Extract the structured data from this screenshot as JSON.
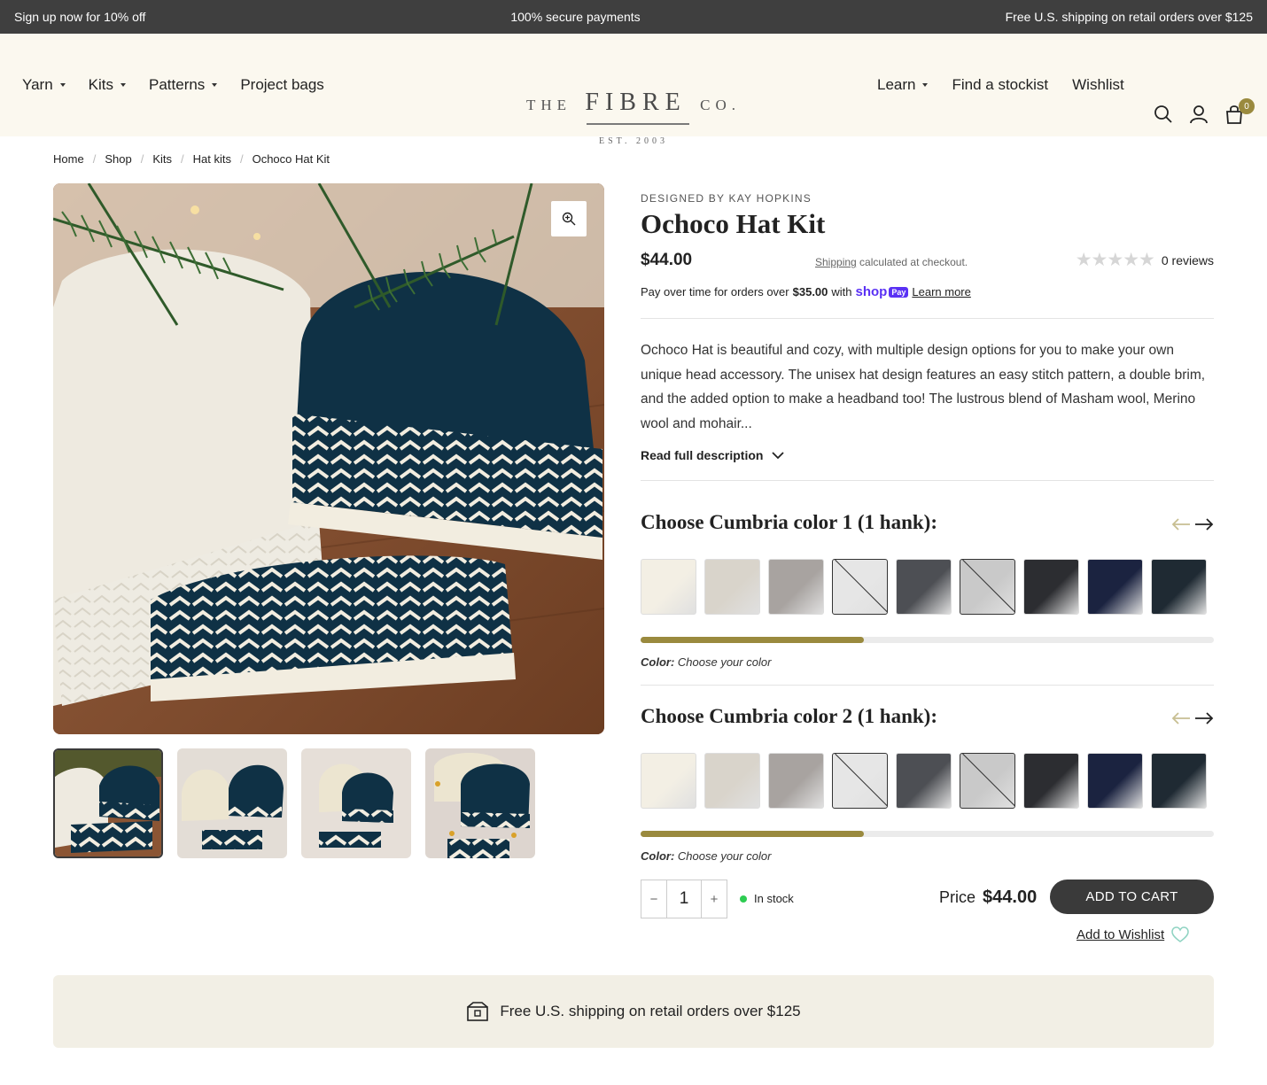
{
  "announcement": {
    "left": "Sign up now for 10% off",
    "center": "100% secure payments",
    "right": "Free U.S. shipping on retail orders over $125"
  },
  "nav": {
    "left": [
      {
        "label": "Yarn",
        "dropdown": true
      },
      {
        "label": "Kits",
        "dropdown": true
      },
      {
        "label": "Patterns",
        "dropdown": true
      },
      {
        "label": "Project bags",
        "dropdown": false
      }
    ],
    "right": [
      {
        "label": "Learn",
        "dropdown": true
      },
      {
        "label": "Find a stockist",
        "dropdown": false
      },
      {
        "label": "Wishlist",
        "dropdown": false
      }
    ],
    "icons": [
      "search-icon",
      "account-icon",
      "cart-icon"
    ],
    "cart_count": "0"
  },
  "logo": {
    "the": "THE",
    "fibre": "FIBRE",
    "co": "CO.",
    "est": "EST. 2003"
  },
  "breadcrumb": [
    "Home",
    "Shop",
    "Kits",
    "Hat kits",
    "Ochoco Hat Kit"
  ],
  "product": {
    "designer": "DESIGNED BY KAY HOPKINS",
    "title": "Ochoco Hat Kit",
    "price": "$44.00",
    "shipping_link": "Shipping",
    "shipping_text": " calculated at checkout.",
    "reviews": "0 reviews",
    "rating": 0,
    "payover_text": "Pay over time for orders over ",
    "payover_amount": "$35.00",
    "payover_with": " with",
    "shop_label": "shop",
    "pay_badge": "Pay",
    "learn_more": "Learn more",
    "description": "Ochoco Hat is beautiful and cozy, with multiple design options for you to make your own unique head accessory. The unisex hat design features an easy stitch pattern, a double brim, and the added option to make a headband too! The lustrous blend of Masham wool, Merino wool and mohair...",
    "read_more": "Read full description"
  },
  "color_pickers": [
    {
      "title": "Choose Cumbria color 1 (1 hank):",
      "color_label": "Color:",
      "color_value": "Choose your color",
      "scroll_progress": 0.39
    },
    {
      "title": "Choose Cumbria color 2 (1 hank):",
      "color_label": "Color:",
      "color_value": "Choose your color",
      "scroll_progress": 0.39
    }
  ],
  "swatch_colors": [
    "#f3efe4",
    "#d9d4cb",
    "#a8a3a0",
    "#e6e6e6",
    "#4d4f54",
    "#c9c9c9",
    "#2c2d31",
    "#1b2340",
    "#1f2a33"
  ],
  "swatch_unavailable": [
    false,
    false,
    false,
    true,
    false,
    true,
    false,
    false,
    false
  ],
  "purchase": {
    "quantity": "1",
    "minus": "−",
    "plus": "+",
    "stock": "In stock",
    "price_label": "Price",
    "price": "$44.00",
    "add_to_cart": "ADD TO CART",
    "wishlist": "Add to Wishlist"
  },
  "banner": {
    "text": "Free U.S. shipping on retail orders over $125"
  },
  "colors": {
    "accent": "#9a8a3e",
    "dark": "#3a3a3a",
    "header_bg": "#fbf8ef",
    "banner_bg": "#f2efe5",
    "shop_pay": "#5a31f4",
    "in_stock": "#2ecc52"
  }
}
